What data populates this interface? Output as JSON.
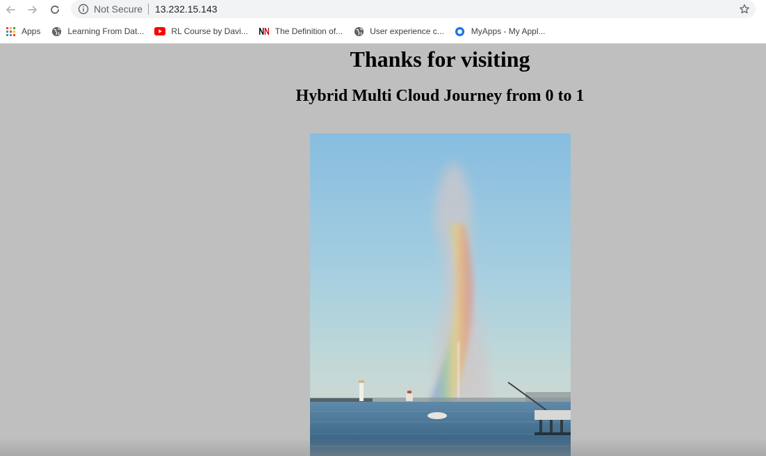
{
  "browser": {
    "security_label": "Not Secure",
    "url": "13.232.15.143"
  },
  "bookmarks": [
    {
      "label": "Apps",
      "icon": "apps-grid-icon"
    },
    {
      "label": "Learning From Dat...",
      "icon": "globe-icon"
    },
    {
      "label": "RL Course by Davi...",
      "icon": "youtube-icon"
    },
    {
      "label": "The Definition of...",
      "icon": "nn-logo-icon"
    },
    {
      "label": "User experience c...",
      "icon": "globe-icon"
    },
    {
      "label": "MyApps - My Appl...",
      "icon": "myapps-icon"
    }
  ],
  "page": {
    "title": "Thanks for visiting",
    "subtitle": "Hybrid Multi Cloud Journey from 0 to 1",
    "image_subject": "fountain-with-rainbow-over-lake"
  },
  "colors": {
    "page_background": "#bfbfbf",
    "omnibox_background": "#f1f3f4",
    "youtube_red": "#ff0000",
    "nn_red": "#d0021b",
    "myapps_blue": "#1a73e8"
  }
}
